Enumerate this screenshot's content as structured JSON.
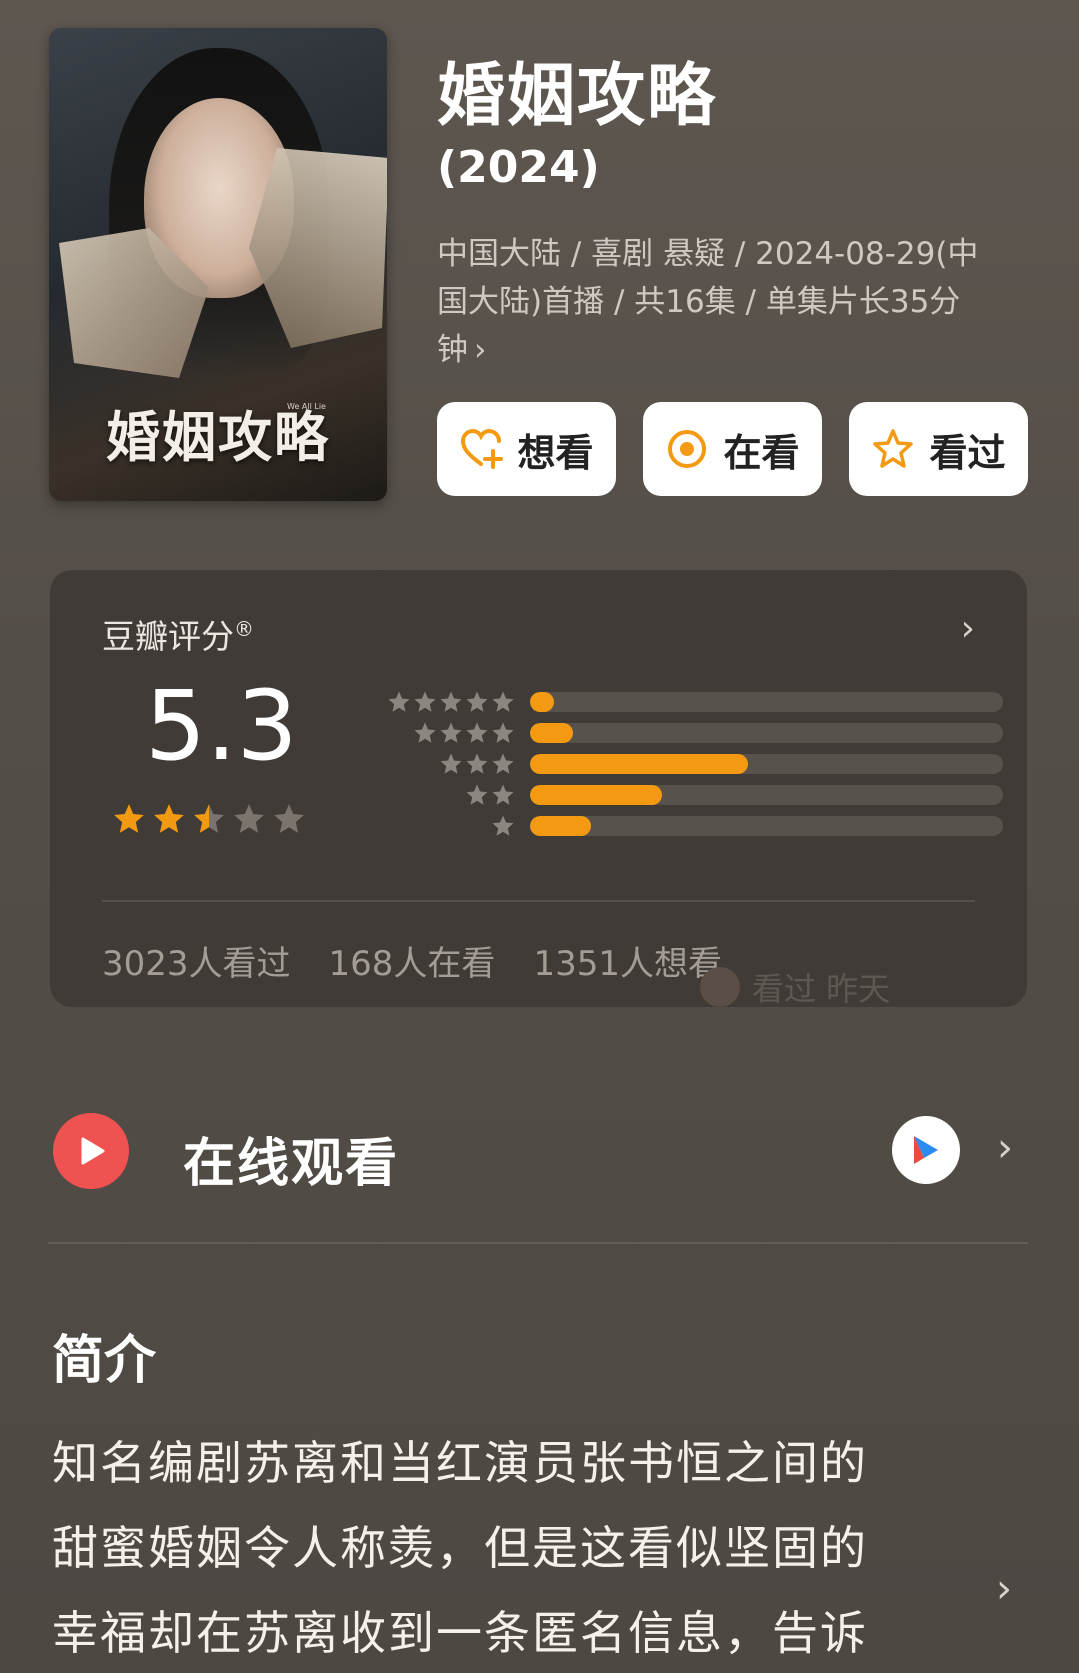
{
  "header": {
    "title": "婚姻攻略",
    "year": "(2024)",
    "meta": "中国大陆 / 喜剧 悬疑 / 2024-08-29(中国大陆)首播 / 共16集 / 单集片长35分钟",
    "poster_title": "婚姻攻略",
    "poster_subtitle": "We All Lie"
  },
  "actions": [
    {
      "label": "想看",
      "icon": "heart-plus-icon"
    },
    {
      "label": "在看",
      "icon": "target-icon"
    },
    {
      "label": "看过",
      "icon": "star-outline-icon"
    }
  ],
  "rating": {
    "label": "豆瓣评分",
    "registered": "®",
    "score": "5.3",
    "stars_filled": 2.5,
    "distribution": [
      {
        "stars": 5,
        "fraction": 0.05
      },
      {
        "stars": 4,
        "fraction": 0.09
      },
      {
        "stars": 3,
        "fraction": 0.46
      },
      {
        "stars": 2,
        "fraction": 0.28
      },
      {
        "stars": 1,
        "fraction": 0.13
      }
    ],
    "counts": [
      "3023人看过",
      "168人在看",
      "1351人想看"
    ],
    "ghost_text": "看过 昨天"
  },
  "watch": {
    "label": "在线观看"
  },
  "intro": {
    "title": "简介",
    "lines": [
      "知名编剧苏离和当红演员张书恒之间的",
      "甜蜜婚姻令人称羡，但是这看似坚固的",
      "幸福却在苏离收到一条匿名信息，告诉"
    ]
  },
  "colors": {
    "accent": "#f39a12",
    "play_red": "#f05151",
    "background": "#56504a",
    "card": "#403b37"
  }
}
